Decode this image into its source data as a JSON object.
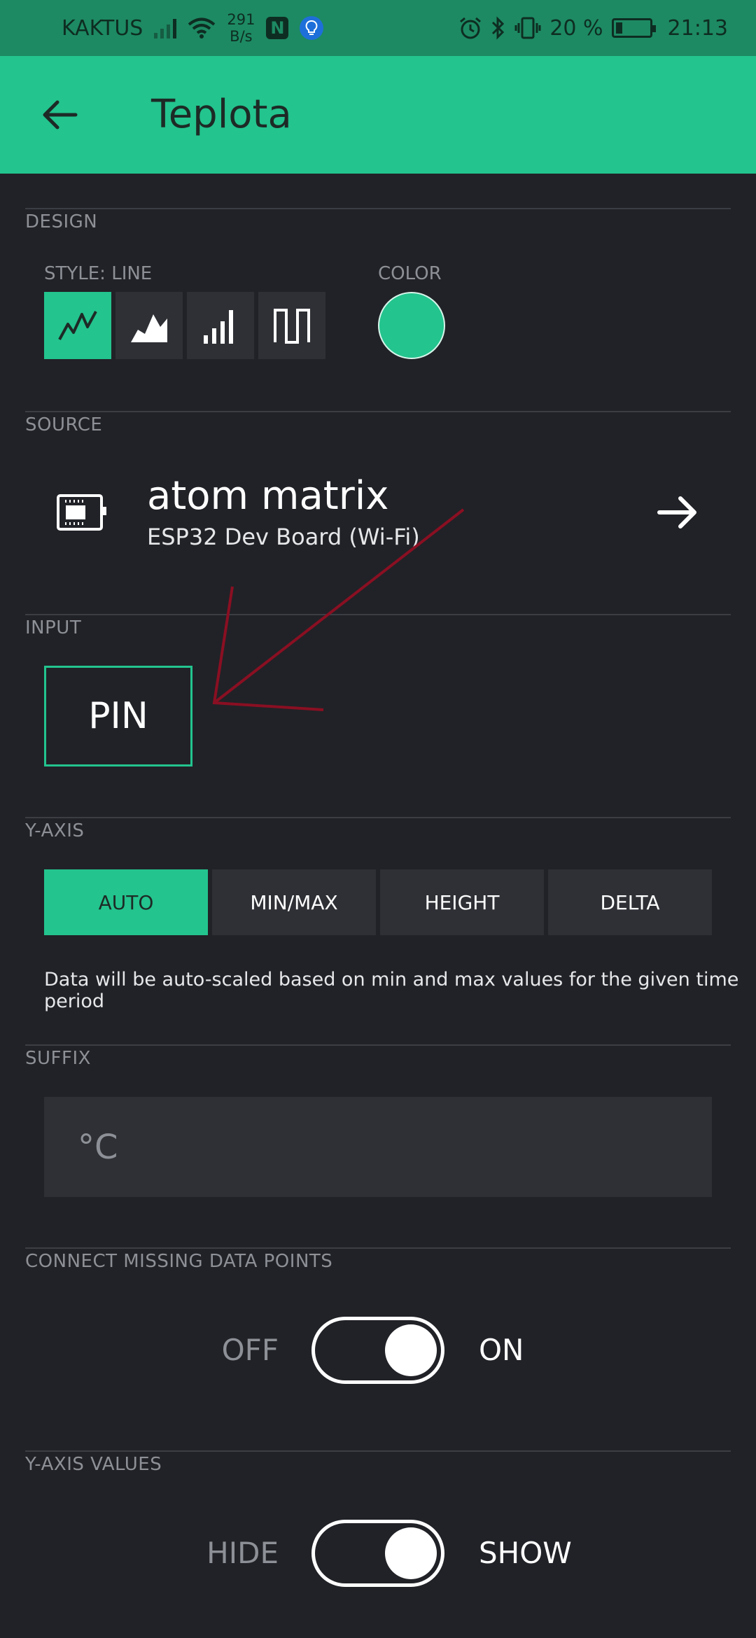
{
  "status_bar": {
    "carrier": "KAKTUS",
    "net_speed_value": "291",
    "net_speed_unit": "B/s",
    "nfc_label": "N",
    "battery_percent": "20 %",
    "battery_level": 0.2,
    "time": "21:13"
  },
  "app_bar": {
    "back_icon": "arrow-left-icon",
    "title": "Teplota"
  },
  "design": {
    "section_label": "DESIGN",
    "style_label": "STYLE: LINE",
    "styles": [
      {
        "name": "line",
        "icon": "line-chart-icon",
        "active": true
      },
      {
        "name": "area",
        "icon": "area-chart-icon",
        "active": false
      },
      {
        "name": "bar",
        "icon": "bar-chart-icon",
        "active": false
      },
      {
        "name": "binary",
        "icon": "binary-chart-icon",
        "active": false
      }
    ],
    "color_label": "COLOR",
    "color_value": "#23c48e"
  },
  "source": {
    "section_label": "SOURCE",
    "device_name": "atom matrix",
    "device_type": "ESP32 Dev Board (Wi-Fi)"
  },
  "input": {
    "section_label": "INPUT",
    "pin_label": "PIN"
  },
  "y_axis": {
    "section_label": "Y-AXIS",
    "options": [
      "AUTO",
      "MIN/MAX",
      "HEIGHT",
      "DELTA"
    ],
    "selected": "AUTO",
    "hint": "Data will be auto-scaled based on min and max values for the given time period"
  },
  "suffix": {
    "section_label": "SUFFIX",
    "value": "°C"
  },
  "connect_missing": {
    "section_label": "CONNECT MISSING DATA POINTS",
    "off_label": "OFF",
    "on_label": "ON",
    "state": true
  },
  "y_axis_values": {
    "section_label": "Y-AXIS VALUES",
    "off_label": "HIDE",
    "on_label": "SHOW",
    "state": true
  },
  "colors": {
    "accent": "#23c48e",
    "status_bar": "#1d8a63",
    "background": "#212227",
    "annotation_arrow": "#8a0f22"
  }
}
